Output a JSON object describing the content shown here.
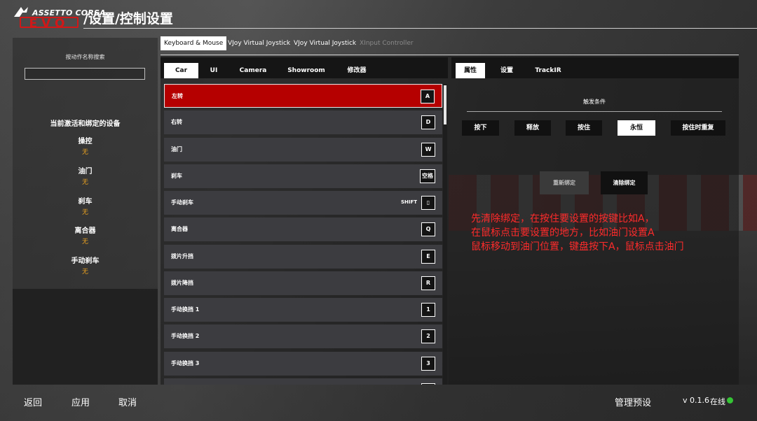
{
  "header": {
    "logo_top": "ASSETTO CORSA",
    "logo_bottom": "EVO",
    "title": "/设置/控制设置"
  },
  "sidebar": {
    "search_label": "按动作名称搜索",
    "search_value": "",
    "devices_title": "当前激活和绑定的设备",
    "devices": [
      {
        "name": "操控",
        "value": "无"
      },
      {
        "name": "油门",
        "value": "无"
      },
      {
        "name": "刹车",
        "value": "无"
      },
      {
        "name": "离合器",
        "value": "无"
      },
      {
        "name": "手动刹车",
        "value": "无"
      }
    ]
  },
  "device_tabs": [
    {
      "label": "Keyboard & Mouse",
      "active": true
    },
    {
      "label": "VJoy Virtual Joystick",
      "active": false
    },
    {
      "label": "VJoy Virtual Joystick",
      "active": false
    },
    {
      "label": "XInput Controller",
      "active": false,
      "disabled": true
    }
  ],
  "category_tabs": [
    {
      "label": "Car",
      "active": true
    },
    {
      "label": "UI",
      "active": false
    },
    {
      "label": "Camera",
      "active": false
    },
    {
      "label": "Showroom",
      "active": false
    },
    {
      "label": "修改器",
      "active": false
    }
  ],
  "right_tabs": [
    {
      "label": "属性",
      "active": true
    },
    {
      "label": "设置",
      "active": false
    },
    {
      "label": "TrackIR",
      "active": false
    }
  ],
  "bindings": [
    {
      "label": "左转",
      "key": "A",
      "modifier": "",
      "selected": true
    },
    {
      "label": "右转",
      "key": "D",
      "modifier": "",
      "selected": false
    },
    {
      "label": "油门",
      "key": "W",
      "modifier": "",
      "selected": false
    },
    {
      "label": "刹车",
      "key": "空格",
      "modifier": "",
      "selected": false
    },
    {
      "label": "手动刹车",
      "key": "▯",
      "modifier": "SHIFT",
      "selected": false
    },
    {
      "label": "离合器",
      "key": "Q",
      "modifier": "",
      "selected": false
    },
    {
      "label": "拨片升挡",
      "key": "E",
      "modifier": "",
      "selected": false
    },
    {
      "label": "拨片降挡",
      "key": "R",
      "modifier": "",
      "selected": false
    },
    {
      "label": "手动换挡 1",
      "key": "1",
      "modifier": "",
      "selected": false
    },
    {
      "label": "手动换挡 2",
      "key": "2",
      "modifier": "",
      "selected": false
    },
    {
      "label": "手动换挡 3",
      "key": "3",
      "modifier": "",
      "selected": false
    },
    {
      "label": "",
      "key": "",
      "modifier": "",
      "selected": false
    }
  ],
  "trigger": {
    "title": "触发条件",
    "buttons": [
      {
        "label": "按下",
        "active": false
      },
      {
        "label": "释放",
        "active": false
      },
      {
        "label": "按住",
        "active": false
      },
      {
        "label": "永恒",
        "active": true
      },
      {
        "label": "按住时重复",
        "active": false
      }
    ],
    "rebind_label": "重新绑定",
    "clear_label": "清除绑定"
  },
  "note_lines": [
    "先清除绑定，在按住要设置的按键比如A，",
    "在鼠标点击要设置的地方，比如油门设置A",
    "鼠标移动到油门位置，键盘按下A，鼠标点击油门"
  ],
  "footer": {
    "back": "返回",
    "apply": "应用",
    "cancel": "取消",
    "manage_presets": "管理预设",
    "version": "v 0.1.6",
    "status": "在线",
    "status_color": "#35c435"
  },
  "colors": {
    "selected_row": "#b50000",
    "device_value": "#e8a020",
    "note": "#ff2b2b"
  }
}
